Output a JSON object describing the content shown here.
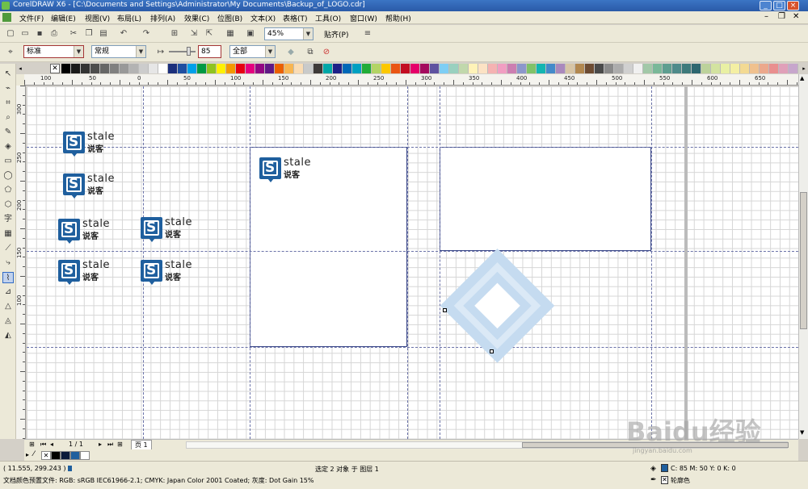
{
  "titlebar": {
    "title": "CorelDRAW X6 - [C:\\Documents and Settings\\Administrator\\My Documents\\Backup_of_LOGO.cdr]",
    "minimize": "_",
    "maximize": "□",
    "close": "×"
  },
  "menu": [
    "文件(F)",
    "编辑(E)",
    "视图(V)",
    "布局(L)",
    "排列(A)",
    "效果(C)",
    "位图(B)",
    "文本(X)",
    "表格(T)",
    "工具(O)",
    "窗口(W)",
    "帮助(H)"
  ],
  "toolbar1": {
    "zoom": "45%",
    "snap": "贴齐(P)"
  },
  "toolbar2": {
    "style": "标准",
    "weight": "常规",
    "angle_value": "85",
    "scope": "全部"
  },
  "palette": [
    "#000000",
    "#1a1a1a",
    "#333333",
    "#4d4d4d",
    "#666666",
    "#808080",
    "#999999",
    "#b3b3b3",
    "#cccccc",
    "#e6e6e6",
    "#ffffff",
    "#1b2f7c",
    "#1f4fa1",
    "#00a0e9",
    "#009944",
    "#8fc31f",
    "#fff100",
    "#f39800",
    "#e60012",
    "#e4007f",
    "#920783",
    "#601986",
    "#eb6100",
    "#f8b551",
    "#fadcb4",
    "#c9caca",
    "#3e3a39",
    "#00a7a7",
    "#1d2088",
    "#0068b7",
    "#00a0c1",
    "#22ac38",
    "#b3d465",
    "#fcc800",
    "#ea5514",
    "#c30d23",
    "#e5006a",
    "#a40b5d",
    "#5f52a0",
    "#7ecef4",
    "#99d0bf",
    "#c1d8ac",
    "#fff3b8",
    "#fce2c4",
    "#f5b2b2",
    "#f19ec2",
    "#cc7eb1",
    "#8c97cb",
    "#80c269",
    "#13b5b1",
    "#448aca",
    "#aa89bd",
    "#d7c5a6",
    "#b28850",
    "#6d4c33",
    "#4a4a4a",
    "#8a8a8a",
    "#acacac",
    "#d0d0d0",
    "#f0f0f0",
    "#a2c8a8",
    "#7ab899",
    "#5e9e90",
    "#4f8b8b",
    "#3e7a7c",
    "#2e6770",
    "#bcd29b",
    "#d3e3a0",
    "#e9f0a4",
    "#f4efa3",
    "#f3da93",
    "#f0c18e",
    "#eca88c",
    "#e98f8f",
    "#e0a0b9",
    "#c7a6cc"
  ],
  "ruler_h": [
    "100",
    "50",
    "0",
    "50",
    "100",
    "150",
    "200",
    "250",
    "300",
    "350",
    "400",
    "450",
    "500",
    "550",
    "600",
    "650"
  ],
  "ruler_v": [
    "300",
    "250",
    "200",
    "150",
    "100"
  ],
  "logo_text": {
    "word1": "stale",
    "word2": "说客"
  },
  "page_nav": {
    "position": "1 / 1",
    "tab": "页 1"
  },
  "status": {
    "coords": "( 11.555, 299.243 )",
    "selection": "选定 2 对象 于 图层 1",
    "color_profile": "文档颜色预置文件: RGB: sRGB IEC61966-2.1; CMYK: Japan Color 2001 Coated; 灰度: Dot Gain 15%",
    "fill": "C: 85 M: 50 Y: 0 K: 0",
    "outline": "轮廓色"
  },
  "watermark": {
    "big": "Baidu经验",
    "small": "jingyan.baidu.com"
  }
}
